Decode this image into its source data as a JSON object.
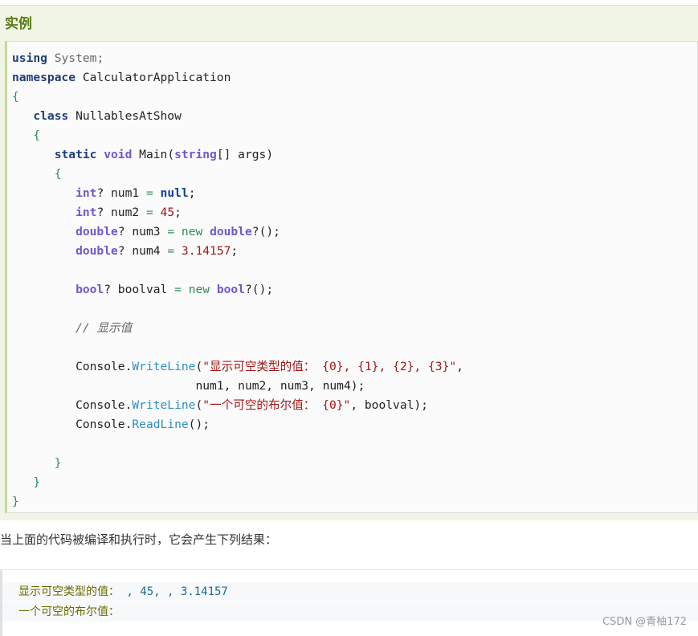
{
  "example": {
    "title": "实例",
    "code_lines": [
      [
        {
          "t": "using",
          "c": "kw"
        },
        {
          "t": " System;",
          "c": "ns"
        }
      ],
      [
        {
          "t": "namespace",
          "c": "kw"
        },
        {
          "t": " CalculatorApplication",
          "c": ""
        }
      ],
      [
        {
          "t": "{",
          "c": "br"
        }
      ],
      [
        {
          "t": "   ",
          "c": ""
        },
        {
          "t": "class",
          "c": "kw"
        },
        {
          "t": " NullablesAtShow",
          "c": ""
        }
      ],
      [
        {
          "t": "   ",
          "c": ""
        },
        {
          "t": "{",
          "c": "br"
        }
      ],
      [
        {
          "t": "      ",
          "c": ""
        },
        {
          "t": "static",
          "c": "kw"
        },
        {
          "t": " ",
          "c": ""
        },
        {
          "t": "void",
          "c": "ty"
        },
        {
          "t": " Main(",
          "c": ""
        },
        {
          "t": "string",
          "c": "ty"
        },
        {
          "t": "[] args)",
          "c": ""
        }
      ],
      [
        {
          "t": "      ",
          "c": ""
        },
        {
          "t": "{",
          "c": "br"
        }
      ],
      [
        {
          "t": "         ",
          "c": ""
        },
        {
          "t": "int",
          "c": "ty"
        },
        {
          "t": "? num1 ",
          "c": ""
        },
        {
          "t": "=",
          "c": "op"
        },
        {
          "t": " ",
          "c": ""
        },
        {
          "t": "null",
          "c": "nul"
        },
        {
          "t": ";",
          "c": ""
        }
      ],
      [
        {
          "t": "         ",
          "c": ""
        },
        {
          "t": "int",
          "c": "ty"
        },
        {
          "t": "? num2 ",
          "c": ""
        },
        {
          "t": "=",
          "c": "op"
        },
        {
          "t": " ",
          "c": ""
        },
        {
          "t": "45",
          "c": "num"
        },
        {
          "t": ";",
          "c": ""
        }
      ],
      [
        {
          "t": "         ",
          "c": ""
        },
        {
          "t": "double",
          "c": "ty"
        },
        {
          "t": "? num3 ",
          "c": ""
        },
        {
          "t": "=",
          "c": "op"
        },
        {
          "t": " ",
          "c": ""
        },
        {
          "t": "new",
          "c": "op"
        },
        {
          "t": " ",
          "c": ""
        },
        {
          "t": "double",
          "c": "ty"
        },
        {
          "t": "?();",
          "c": ""
        }
      ],
      [
        {
          "t": "         ",
          "c": ""
        },
        {
          "t": "double",
          "c": "ty"
        },
        {
          "t": "? num4 ",
          "c": ""
        },
        {
          "t": "=",
          "c": "op"
        },
        {
          "t": " ",
          "c": ""
        },
        {
          "t": "3.14157",
          "c": "num"
        },
        {
          "t": ";",
          "c": ""
        }
      ],
      [
        {
          "t": "",
          "c": ""
        }
      ],
      [
        {
          "t": "         ",
          "c": ""
        },
        {
          "t": "bool",
          "c": "ty"
        },
        {
          "t": "? boolval ",
          "c": ""
        },
        {
          "t": "=",
          "c": "op"
        },
        {
          "t": " ",
          "c": ""
        },
        {
          "t": "new",
          "c": "op"
        },
        {
          "t": " ",
          "c": ""
        },
        {
          "t": "bool",
          "c": "ty"
        },
        {
          "t": "?();",
          "c": ""
        }
      ],
      [
        {
          "t": "",
          "c": ""
        }
      ],
      [
        {
          "t": "         ",
          "c": ""
        },
        {
          "t": "// 显示值",
          "c": "cm"
        }
      ],
      [
        {
          "t": "",
          "c": ""
        }
      ],
      [
        {
          "t": "         Console.",
          "c": ""
        },
        {
          "t": "WriteLine",
          "c": "mth"
        },
        {
          "t": "(",
          "c": ""
        },
        {
          "t": "\"显示可空类型的值： {0}, {1}, {2}, {3}\"",
          "c": "str"
        },
        {
          "t": ",",
          "c": ""
        }
      ],
      [
        {
          "t": "                          num1, num2, num3, num4);",
          "c": ""
        }
      ],
      [
        {
          "t": "         Console.",
          "c": ""
        },
        {
          "t": "WriteLine",
          "c": "mth"
        },
        {
          "t": "(",
          "c": ""
        },
        {
          "t": "\"一个可空的布尔值： {0}\"",
          "c": "str"
        },
        {
          "t": ", boolval);",
          "c": ""
        }
      ],
      [
        {
          "t": "         Console.",
          "c": ""
        },
        {
          "t": "ReadLine",
          "c": "mth"
        },
        {
          "t": "();",
          "c": ""
        }
      ],
      [
        {
          "t": "",
          "c": ""
        }
      ],
      [
        {
          "t": "      ",
          "c": ""
        },
        {
          "t": "}",
          "c": "br"
        }
      ],
      [
        {
          "t": "   ",
          "c": ""
        },
        {
          "t": "}",
          "c": "br"
        }
      ],
      [
        {
          "t": "}",
          "c": "br"
        }
      ]
    ]
  },
  "paragraph": "当上面的代码被编译和执行时，它会产生下列结果：",
  "output": {
    "line1_label": "显示可空类型的值：",
    "line1_values": " , 45,  , 3.14157",
    "line2_label": "一个可空的布尔值："
  },
  "watermark": "CSDN @青柚172"
}
